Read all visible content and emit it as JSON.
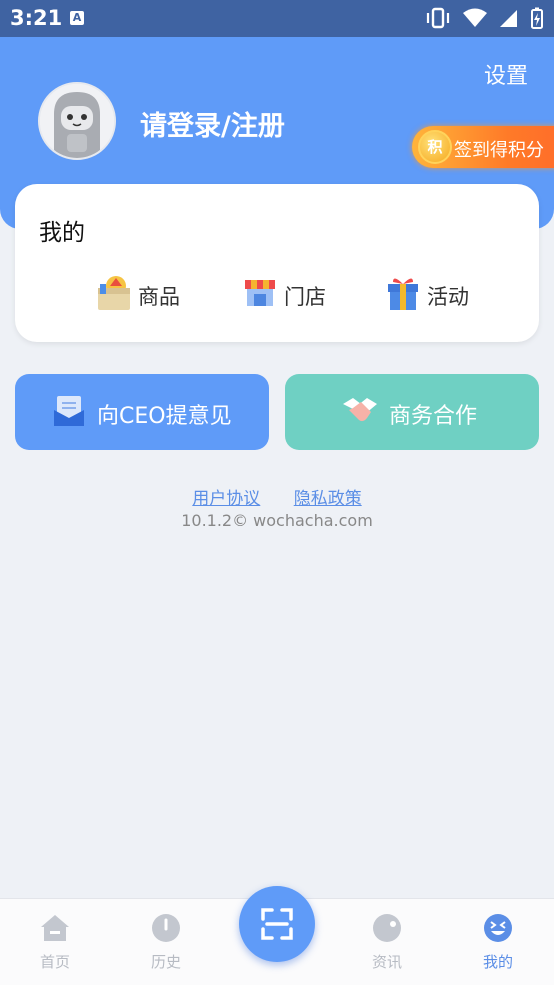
{
  "status": {
    "time": "3:21",
    "a_badge": "A"
  },
  "header": {
    "settings": "设置",
    "login": "请登录/注册",
    "checkin": {
      "coin": "积",
      "label": "签到得积分"
    }
  },
  "mine": {
    "title": "我的",
    "items": [
      {
        "label": "商品",
        "icon": "goods-box-icon"
      },
      {
        "label": "门店",
        "icon": "store-icon"
      },
      {
        "label": "活动",
        "icon": "gift-icon"
      }
    ]
  },
  "actions": {
    "ceo": "向CEO提意见",
    "business": "商务合作"
  },
  "footer": {
    "user_agreement": "用户协议",
    "privacy_policy": "隐私政策",
    "version": "10.1.2© wochacha.com"
  },
  "tabbar": {
    "home": "首页",
    "history": "历史",
    "news": "资讯",
    "mine": "我的"
  },
  "colors": {
    "primary": "#5f9bf8",
    "teal": "#6fd0c3",
    "status_bar": "#3f63a2",
    "checkin_orange": "#ff7a28"
  }
}
